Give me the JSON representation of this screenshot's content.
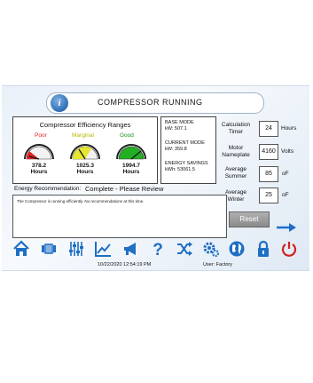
{
  "header": {
    "title": "COMPRESSOR  RUNNING",
    "info_icon": "info-icon"
  },
  "efficiency": {
    "title": "Compressor Efficiency Ranges",
    "gauges": [
      {
        "label": "Poor",
        "color": "#e02020",
        "value": "378.2",
        "unit": "Hours"
      },
      {
        "label": "Marginal",
        "color": "#c8c820",
        "value": "1025.3",
        "unit": "Hours"
      },
      {
        "label": "Good",
        "color": "#20a020",
        "value": "1994.7",
        "unit": "Hours"
      }
    ]
  },
  "modes": {
    "base_label": "BASE MODE",
    "base_value": "kW: 507.1",
    "current_label": "CURRENT MODE",
    "current_value": "kW: 359.8",
    "savings_label": "ENERGY SAVINGS",
    "savings_value": "kWh: 53061.5"
  },
  "settings": {
    "calc_timer_label": "Calculation Timer",
    "calc_timer_value": "24",
    "calc_timer_unit": "Hours",
    "motor_label": "Motor Nameplate",
    "motor_value": "4160",
    "motor_unit": "Volts",
    "summer_label": "Average Summer",
    "summer_value": "85",
    "summer_unit": "oF",
    "winter_label": "Average Winter",
    "winter_value": "25",
    "winter_unit": "oF"
  },
  "recommendation": {
    "label": "Energy Recommendation:",
    "status": "Complete - Please Review",
    "text": "The Compressor is running efficiently. No recommendations at this time."
  },
  "reset_label": "Reset",
  "toolbar": [
    "home-icon",
    "io-module-icon",
    "sliders-icon",
    "trend-chart-icon",
    "megaphone-icon",
    "help-icon",
    "shuffle-icon",
    "settings-gears-icon",
    "globe-icon",
    "lock-icon",
    "power-icon"
  ],
  "footer": {
    "datetime": "10/22/2020 12:54:19 PM",
    "user": "User: Factory"
  },
  "colors": {
    "accent": "#1f6fc4",
    "power": "#d02020"
  }
}
